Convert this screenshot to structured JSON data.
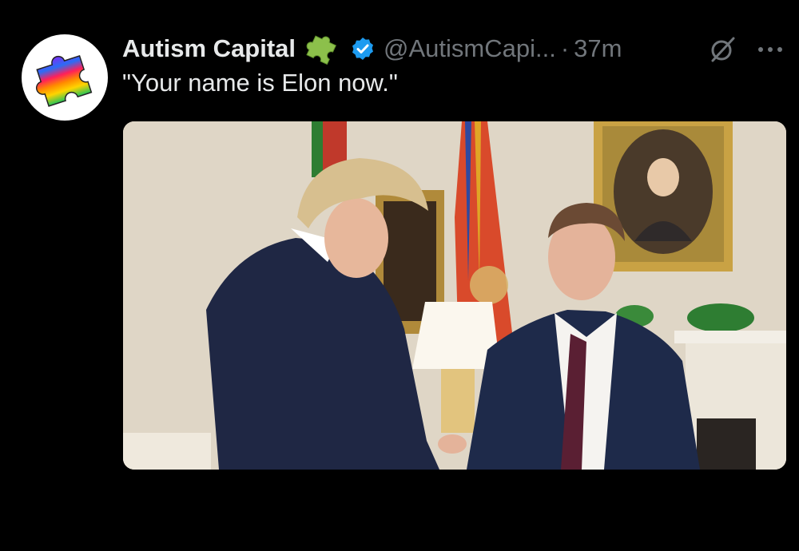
{
  "tweet": {
    "display_name": "Autism Capital",
    "name_emoji": "puzzle-piece-emoji",
    "verified_badge": "verified-badge-icon",
    "handle": "@AutismCapi...",
    "separator": "·",
    "timestamp": "37m",
    "text": "\"Your name is Elon now.\"",
    "actions": {
      "grok_icon": "grok-icon",
      "more_icon": "more-horizontal-icon"
    }
  },
  "colors": {
    "background": "#000000",
    "primary_text": "#e7e9ea",
    "secondary_text": "#71767b",
    "verified_blue": "#1d9bf0",
    "puzzle_green": "#8cc04b"
  },
  "avatar": {
    "icon": "rainbow-puzzle-piece-icon"
  }
}
